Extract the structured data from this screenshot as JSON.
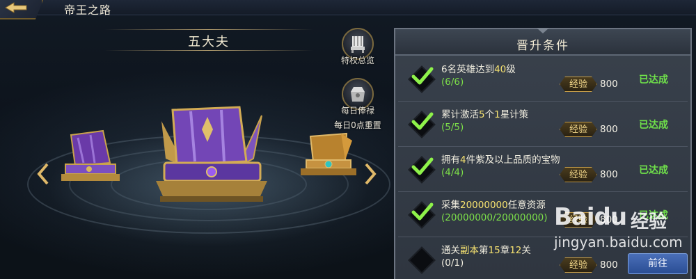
{
  "header": {
    "title": "帝王之路",
    "back_icon": "back-arrow-icon"
  },
  "rank": {
    "name": "五大夫"
  },
  "side_buttons": [
    {
      "label": "特权总览",
      "icon": "throne-icon"
    },
    {
      "label": "每日俸禄",
      "sub_label": "每日0点重置",
      "icon": "salary-chest-icon"
    }
  ],
  "panel": {
    "title": "晋升条件",
    "exp_label": "经验",
    "requirements": [
      {
        "text_parts": [
          "6名英雄达到",
          "40",
          "级"
        ],
        "progress": "(6/6)",
        "exp": "800",
        "status": "已达成",
        "done": true
      },
      {
        "text_parts": [
          "累计激活",
          "5",
          "个",
          "1",
          "星计策"
        ],
        "progress": "(5/5)",
        "exp": "800",
        "status": "已达成",
        "done": true
      },
      {
        "text_parts": [
          "拥有",
          "4",
          "件紫及以上品质的宝物"
        ],
        "progress": "(4/4)",
        "exp": "800",
        "status": "已达成",
        "done": true
      },
      {
        "text_parts": [
          "采集",
          "20000000",
          "任意资源"
        ],
        "progress": "(20000000/20000000)",
        "exp": "800",
        "status": "已达成",
        "done": true
      },
      {
        "text_parts": [
          "通关",
          "副本",
          "第",
          "15",
          "章",
          "12",
          "关"
        ],
        "progress": "(0/1)",
        "exp": "800",
        "status": "前往",
        "done": false
      }
    ]
  },
  "watermark": {
    "logo": "Bai",
    "paw": "du",
    "cn": "经验",
    "url": "jingyan.baidu.com"
  },
  "colors": {
    "done_green": "#6fe04a",
    "highlight_yellow": "#f5e170",
    "gold": "#c39b48",
    "panel_bg": "#343b45"
  }
}
